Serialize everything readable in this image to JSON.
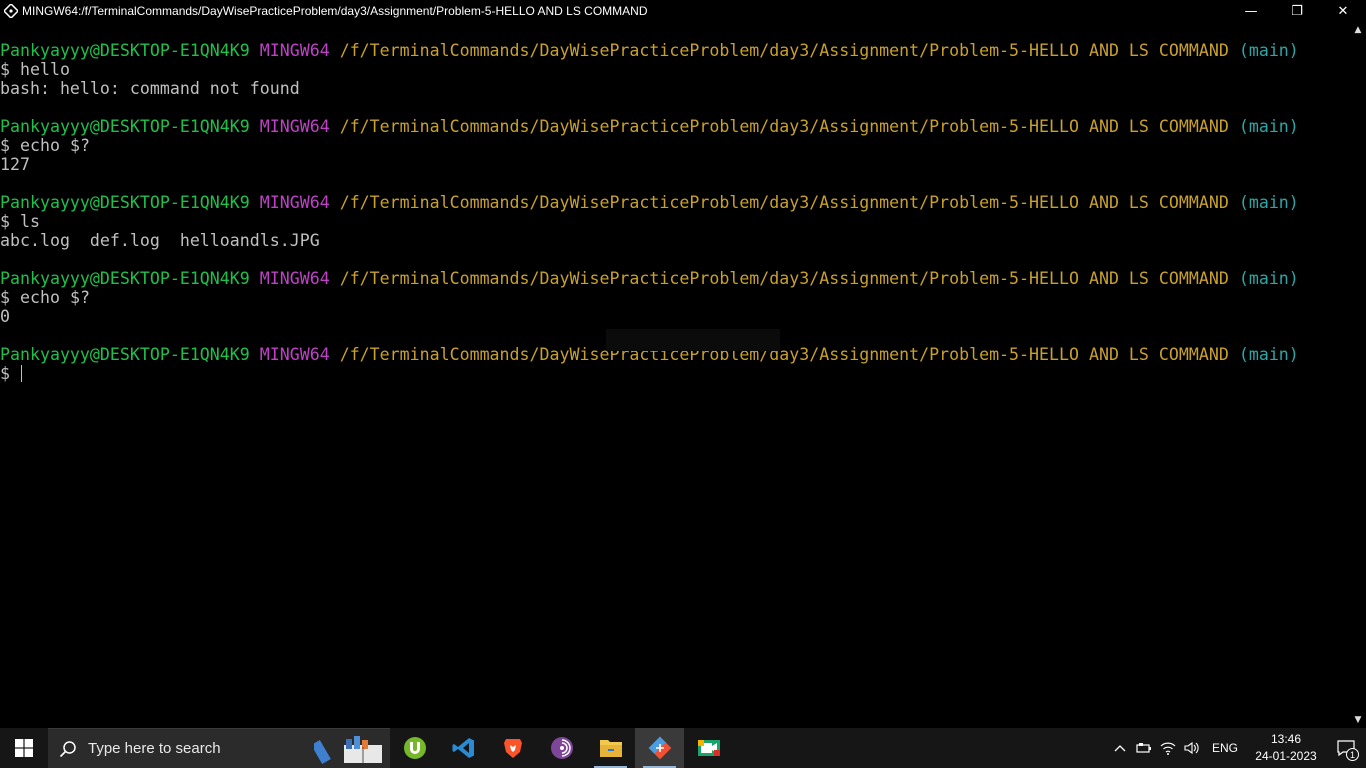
{
  "window": {
    "title": "MINGW64:/f/TerminalCommands/DayWisePracticeProblem/day3/Assignment/Problem-5-HELLO AND LS COMMAND",
    "minimize_glyph": "—",
    "restore_glyph": "❐",
    "close_glyph": "✕"
  },
  "prompt": {
    "user": "Pankyayyy@DESKTOP-E1QN4K9",
    "system": "MINGW64",
    "path": "/f/TerminalCommands/DayWisePracticeProblem/day3/Assignment/Problem-5-HELLO AND LS COMMAND",
    "branch": "(main)",
    "symbol": "$"
  },
  "terminal": {
    "blocks": [
      {
        "command": "hello",
        "output": "bash: hello: command not found"
      },
      {
        "command": "echo $?",
        "output": "127"
      },
      {
        "command": "ls",
        "output": "abc.log  def.log  helloandls.JPG"
      },
      {
        "command": "echo $?",
        "output": "0"
      }
    ]
  },
  "colors": {
    "user": "#1ec04c",
    "system": "#c040c8",
    "path": "#c8a02c",
    "branch": "#2ca6a6",
    "text": "#c0c0c0"
  },
  "taskbar": {
    "search_placeholder": "Type here to search",
    "apps": [
      "utorrent-icon",
      "vscode-icon",
      "brave-icon",
      "tor-browser-icon",
      "file-explorer-icon",
      "git-bash-icon",
      "zoom-meeting-icon"
    ],
    "language": "ENG",
    "time": "13:46",
    "date": "24-01-2023",
    "notification_count": "1"
  }
}
